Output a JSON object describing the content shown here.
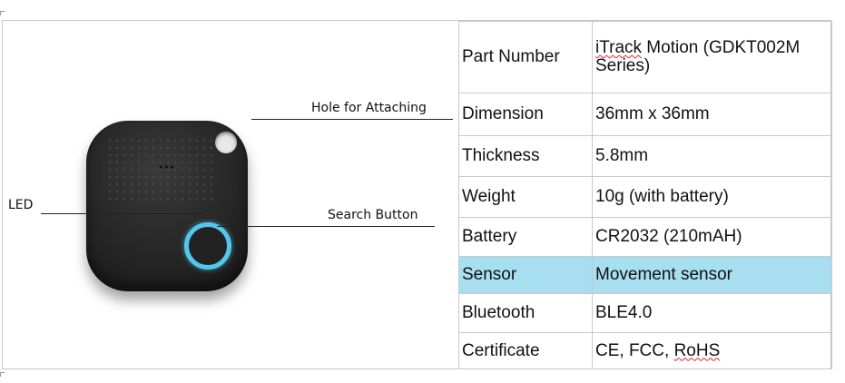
{
  "callouts": {
    "hole": "Hole for Attaching",
    "led": "LED",
    "search": "Search Button"
  },
  "specs": [
    {
      "key": "Part Number",
      "value_prefix": "iTrack",
      "value": " Motion (GDKT002M Series)"
    },
    {
      "key": "Dimension",
      "value": "36mm x 36mm"
    },
    {
      "key": "Thickness",
      "value": "5.8mm"
    },
    {
      "key": "Weight",
      "value": "10g (with battery)"
    },
    {
      "key": "Battery",
      "value": "CR2032 (210mAH)"
    },
    {
      "key": "Sensor",
      "value": "Movement sensor"
    },
    {
      "key": "Bluetooth",
      "value": "BLE4.0"
    },
    {
      "key": "Certificate",
      "value_prefix": "CE, FCC, ",
      "value_suffix": "RoHS"
    }
  ],
  "colors": {
    "highlight_row": "#a7def0",
    "button_ring": "#53c6ec",
    "device_body": "#262626"
  },
  "icons": {
    "device": "bluetooth-tracker-image"
  }
}
